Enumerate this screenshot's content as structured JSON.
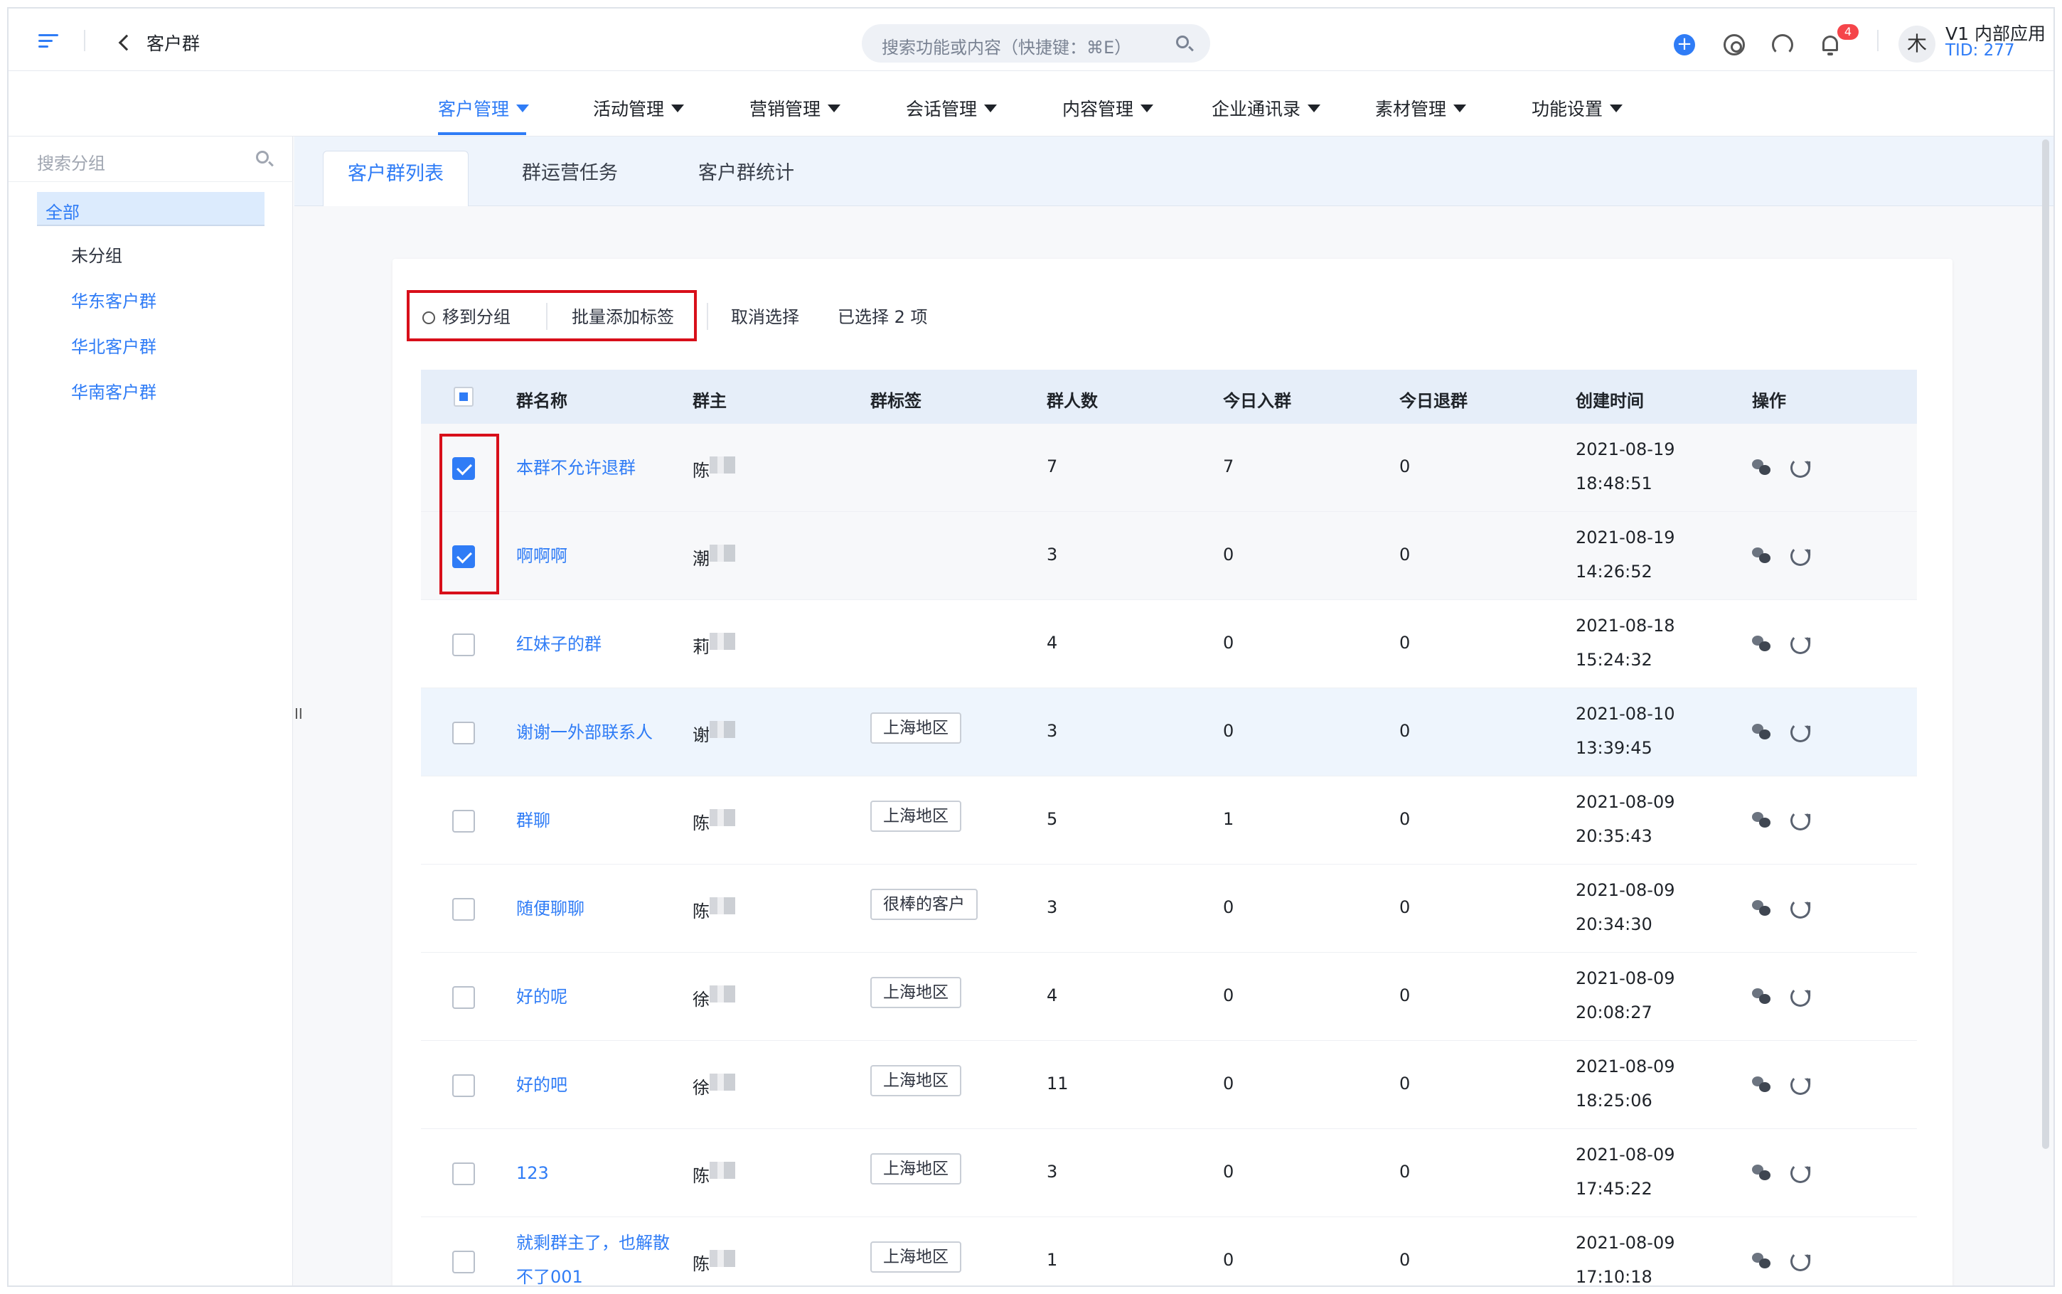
{
  "header": {
    "page_title": "客户群",
    "search_placeholder": "搜索功能或内容（快捷键：⌘E）",
    "notification_count": "4",
    "avatar_text": "木",
    "account_name": "V1 内部应用",
    "account_tid": "TID: 277"
  },
  "nav": {
    "items": [
      "客户管理",
      "活动管理",
      "营销管理",
      "会话管理",
      "内容管理",
      "企业通讯录",
      "素材管理",
      "功能设置"
    ],
    "active": "客户管理"
  },
  "sidebar": {
    "search_placeholder": "搜索分组",
    "all_label": "全部",
    "groups": [
      "未分组",
      "华东客户群",
      "华北客户群",
      "华南客户群"
    ]
  },
  "tabs": [
    "客户群列表",
    "群运营任务",
    "客户群统计"
  ],
  "toolbar": {
    "move_group": "移到分组",
    "batch_tag": "批量添加标签",
    "cancel_select": "取消选择",
    "selected_count": "已选择 2 项"
  },
  "table": {
    "columns": [
      "群名称",
      "群主",
      "群标签",
      "群人数",
      "今日入群",
      "今日退群",
      "创建时间",
      "操作"
    ],
    "rows": [
      {
        "name": "本群不允许退群",
        "owner": "陈",
        "tag": "",
        "members": "7",
        "joined": "7",
        "left": "0",
        "date": "2021-08-19",
        "time": "18:48:51",
        "checked": true
      },
      {
        "name": "啊啊啊",
        "owner": "潮",
        "tag": "",
        "members": "3",
        "joined": "0",
        "left": "0",
        "date": "2021-08-19",
        "time": "14:26:52",
        "checked": true
      },
      {
        "name": "红妹子的群",
        "owner": "莉",
        "tag": "",
        "members": "4",
        "joined": "0",
        "left": "0",
        "date": "2021-08-18",
        "time": "15:24:32",
        "checked": false
      },
      {
        "name": "谢谢一外部联系人",
        "owner": "谢",
        "tag": "上海地区",
        "members": "3",
        "joined": "0",
        "left": "0",
        "date": "2021-08-10",
        "time": "13:39:45",
        "checked": false
      },
      {
        "name": "群聊",
        "owner": "陈",
        "tag": "上海地区",
        "members": "5",
        "joined": "1",
        "left": "0",
        "date": "2021-08-09",
        "time": "20:35:43",
        "checked": false
      },
      {
        "name": "随便聊聊",
        "owner": "陈",
        "tag": "很棒的客户",
        "members": "3",
        "joined": "0",
        "left": "0",
        "date": "2021-08-09",
        "time": "20:34:30",
        "checked": false
      },
      {
        "name": "好的呢",
        "owner": "徐",
        "tag": "上海地区",
        "members": "4",
        "joined": "0",
        "left": "0",
        "date": "2021-08-09",
        "time": "20:08:27",
        "checked": false
      },
      {
        "name": "好的吧",
        "owner": "徐",
        "tag": "上海地区",
        "members": "11",
        "joined": "0",
        "left": "0",
        "date": "2021-08-09",
        "time": "18:25:06",
        "checked": false
      },
      {
        "name": "123",
        "owner": "陈",
        "tag": "上海地区",
        "members": "3",
        "joined": "0",
        "left": "0",
        "date": "2021-08-09",
        "time": "17:45:22",
        "checked": false
      },
      {
        "name": "就剩群主了，也解散不了001",
        "owner": "陈",
        "tag": "上海地区",
        "members": "1",
        "joined": "0",
        "left": "0",
        "date": "2021-08-09",
        "time": "17:10:18",
        "checked": false
      }
    ]
  }
}
